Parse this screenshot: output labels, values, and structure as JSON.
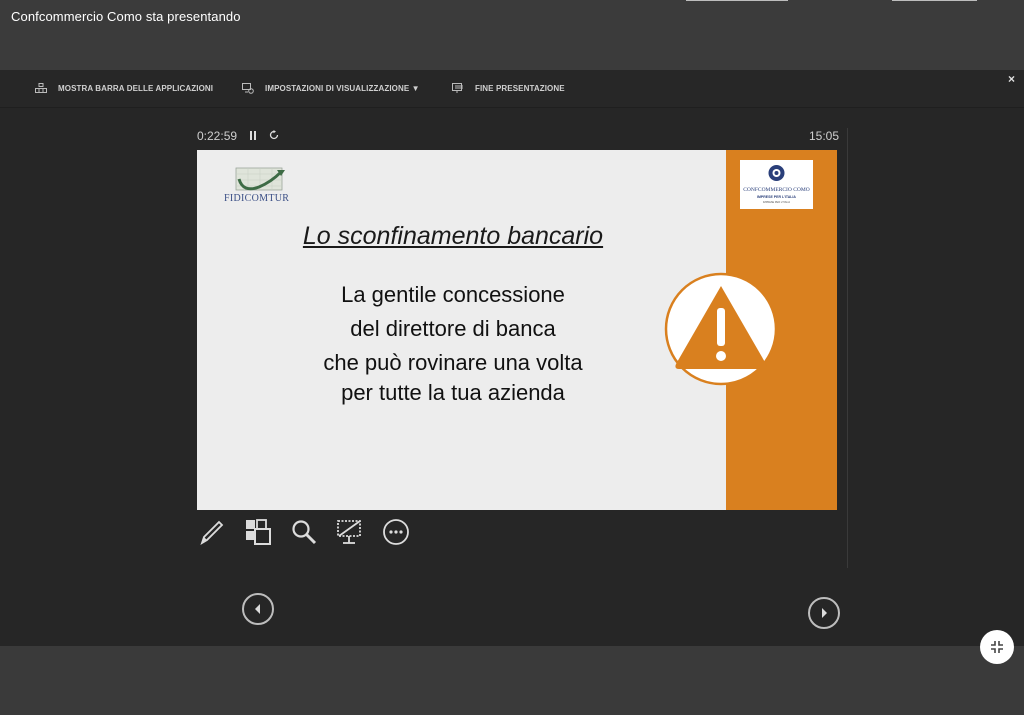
{
  "banner": {
    "presenter_text": "Confcommercio Como sta presentando"
  },
  "toolbar": {
    "items": [
      {
        "label": "MOSTRA BARRA DELLE APPLICAZIONI",
        "icon": "taskbar-icon"
      },
      {
        "label": "IMPOSTAZIONI DI VISUALIZZAZIONE ▼",
        "icon": "display-settings-icon"
      },
      {
        "label": "FINE PRESENTAZIONE",
        "icon": "end-presentation-icon"
      }
    ],
    "close_label": "×"
  },
  "presenter": {
    "elapsed": "0:22:59",
    "clock": "15:05",
    "pause_icon": "pause-icon",
    "restart_icon": "restart-icon"
  },
  "slide": {
    "logo_left_text": "FIDICOMTUR",
    "logo_right_name": "CONFCOMMERCIO COMO",
    "logo_right_tagline": "IMPRESE PER L'ITALIA",
    "logo_right_sub": "IMPRESE PER L'ITALIA",
    "title": "Lo sconfinamento bancario",
    "body_lines": [
      "La gentile concessione",
      "del direttore di banca",
      "che può rovinare una volta",
      "per tutte la tua azienda"
    ],
    "accent_color": "#d9801f",
    "warning_icon": "warning-triangle-icon"
  },
  "tools": [
    "pen-icon",
    "slides-grid-icon",
    "zoom-icon",
    "screen-off-icon",
    "more-options-icon"
  ],
  "nav": {
    "prev_icon": "previous-slide-icon",
    "next_icon": "next-slide-icon"
  },
  "exit_fullscreen_icon": "exit-fullscreen-icon"
}
